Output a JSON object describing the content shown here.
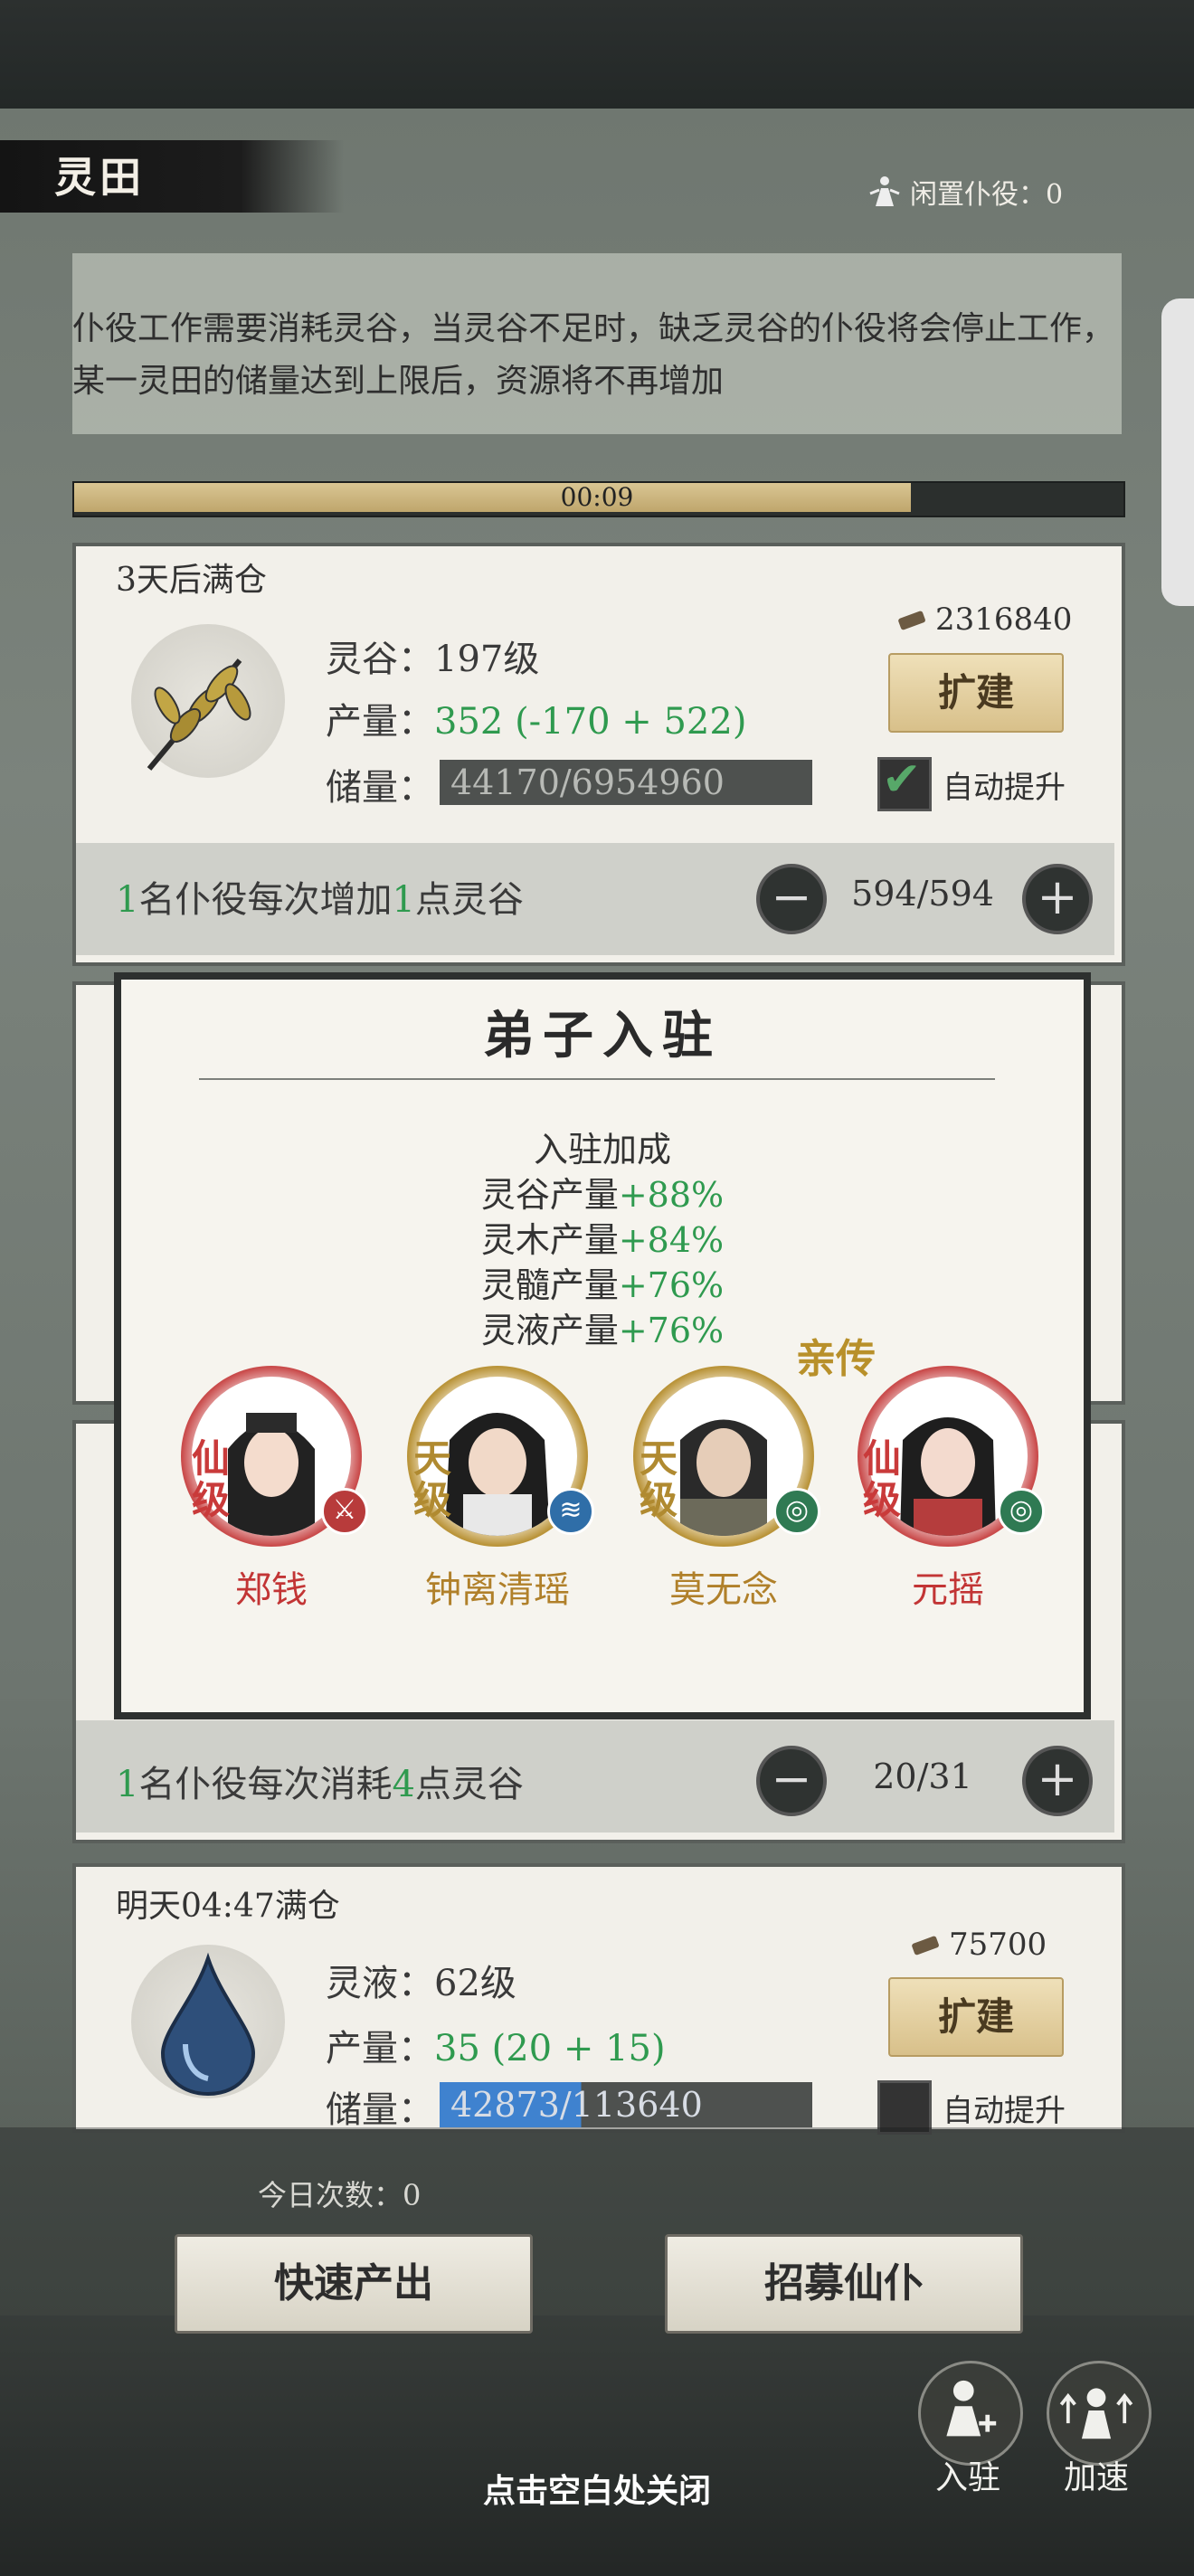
{
  "header": {
    "title": "灵田",
    "idle_label": "闲置仆役：0"
  },
  "notice": {
    "text": "仆役工作需要消耗灵谷，当灵谷不足时，缺乏灵谷的仆役将会停止工作，某一灵田的储量达到上限后，资源将不再增加"
  },
  "timer": {
    "text": "00:09",
    "progress": 0.8
  },
  "card1": {
    "head": "3天后满仓",
    "name": "灵谷：197级",
    "prod_label": "产量：",
    "prod_value": "352 (-170 + 522)",
    "stor_label": "储量：",
    "stor_value": "44170/6954960",
    "cost": "2316840",
    "expand": "扩建",
    "auto": "自动提升",
    "auto_checked": true,
    "foot_n1": "1",
    "foot_t1": "名仆役每次增加",
    "foot_n2": "1",
    "foot_t2": "点灵谷",
    "count": "594/594"
  },
  "card3": {
    "foot_n1": "1",
    "foot_t1": "名仆役每次消耗",
    "foot_n2": "4",
    "foot_t2": "点灵谷",
    "count": "20/31"
  },
  "card4": {
    "head": "明天04:47满仓",
    "name": "灵液：62级",
    "prod_label": "产量：",
    "prod_value": "35 (20 + 15)",
    "stor_label": "储量：",
    "stor_value": "42873/113640",
    "cost": "75700",
    "expand": "扩建",
    "auto": "自动提升",
    "auto_checked": false
  },
  "modal": {
    "title": "弟子入驻",
    "bonus_title": "入驻加成",
    "bonuses": [
      {
        "label": "灵谷产量",
        "value": "+88%"
      },
      {
        "label": "灵木产量",
        "value": "+84%"
      },
      {
        "label": "灵髓产量",
        "value": "+76%"
      },
      {
        "label": "灵液产量",
        "value": "+76%"
      }
    ],
    "tag": "亲传",
    "disciples": [
      {
        "name": "郑钱",
        "grade": "仙级",
        "color": "#c93a3a"
      },
      {
        "name": "钟离清瑶",
        "grade": "天级",
        "color": "#b08a30"
      },
      {
        "name": "莫无念",
        "grade": "天级",
        "color": "#b08a30"
      },
      {
        "name": "元摇",
        "grade": "仙级",
        "color": "#c93a3a"
      }
    ]
  },
  "bottom": {
    "daily": "今日次数：0",
    "btn_fast": "快速产出",
    "btn_recruit": "招募仙仆",
    "btn_station": "入驻",
    "btn_speed": "加速",
    "close_hint": "点击空白处关闭"
  }
}
